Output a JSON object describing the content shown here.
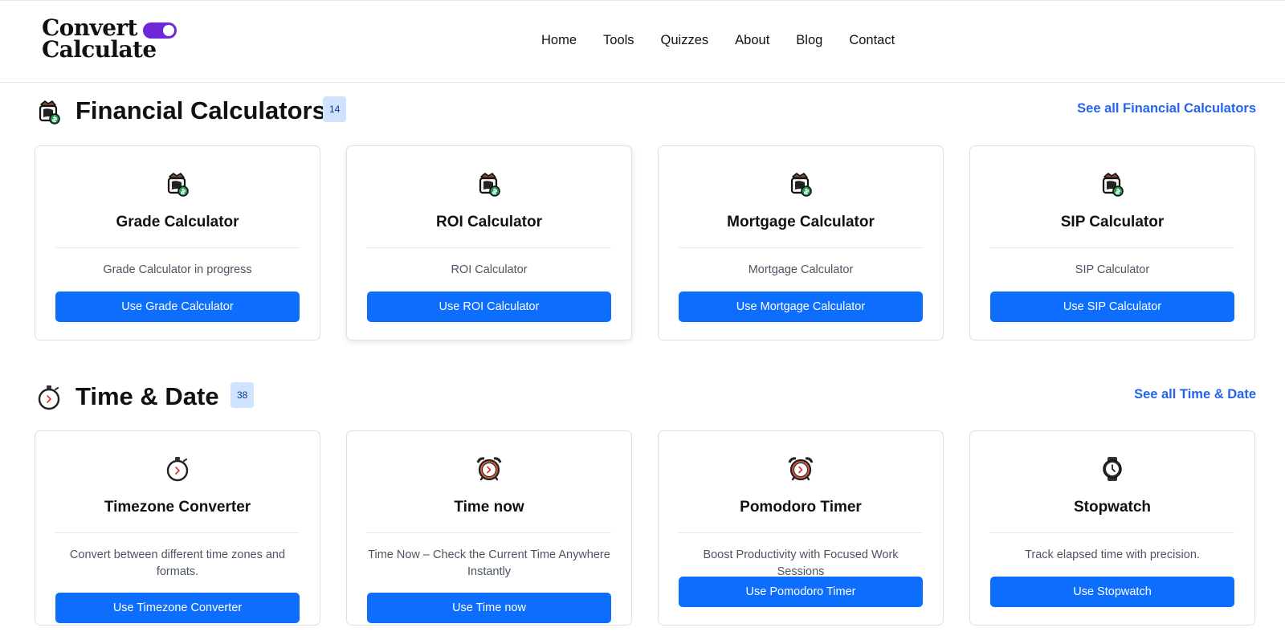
{
  "brand": {
    "line1": "Convert",
    "line2": "Calculate",
    "accent_color": "#6d28d9"
  },
  "nav": {
    "items": [
      {
        "label": "Home"
      },
      {
        "label": "Tools"
      },
      {
        "label": "Quizzes"
      },
      {
        "label": "About"
      },
      {
        "label": "Blog"
      },
      {
        "label": "Contact"
      }
    ]
  },
  "sections": [
    {
      "title": "Financial Calculators",
      "count": "14",
      "see_all": "See all Financial Calculators",
      "icon": "money-bag-icon",
      "cards": [
        {
          "title": "Grade Calculator",
          "description": "Grade Calculator in progress",
          "button": "Use Grade Calculator",
          "icon": "money-bag-icon"
        },
        {
          "title": "ROI Calculator",
          "description": "ROI Calculator",
          "button": "Use ROI Calculator",
          "icon": "money-bag-icon"
        },
        {
          "title": "Mortgage Calculator",
          "description": "Mortgage Calculator",
          "button": "Use Mortgage Calculator",
          "icon": "money-bag-icon"
        },
        {
          "title": "SIP Calculator",
          "description": "SIP Calculator",
          "button": "Use SIP Calculator",
          "icon": "money-bag-icon"
        }
      ]
    },
    {
      "title": "Time & Date",
      "count": "38",
      "see_all": "See all Time & Date",
      "icon": "stopwatch-icon",
      "cards": [
        {
          "title": "Timezone Converter",
          "description": "Convert between different time zones and formats.",
          "button": "Use Timezone Converter",
          "icon": "stopwatch-icon"
        },
        {
          "title": "Time now",
          "description": "Time Now – Check the Current Time Anywhere Instantly",
          "button": "Use Time now",
          "icon": "alarm-clock-icon"
        },
        {
          "title": "Pomodoro Timer",
          "description": "Boost Productivity with Focused Work Sessions",
          "button": "Use Pomodoro Timer",
          "icon": "alarm-clock-icon"
        },
        {
          "title": "Stopwatch",
          "description": "Track elapsed time with precision.",
          "button": "Use Stopwatch",
          "icon": "watch-icon"
        }
      ]
    }
  ],
  "colors": {
    "primary_button": "#0d6efd",
    "link": "#2563eb",
    "badge_bg": "#cfe2ff"
  }
}
